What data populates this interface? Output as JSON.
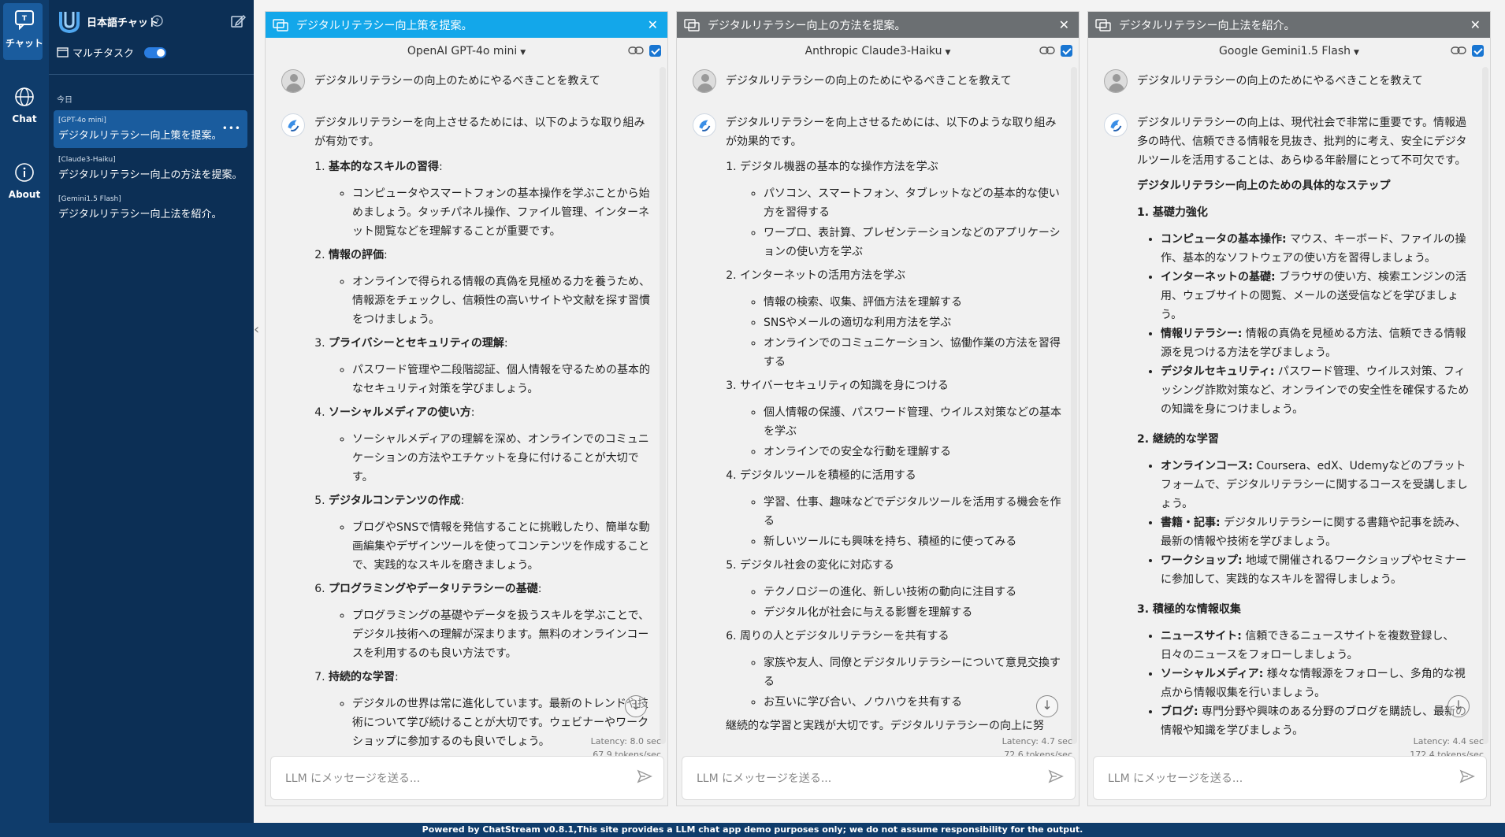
{
  "rail": {
    "chat_label": "チャット",
    "chat2_label": "Chat",
    "about_label": "About"
  },
  "sidebar": {
    "title": "日本語チャット",
    "multitask_label": "マルチタスク",
    "today_label": "今日",
    "history": [
      {
        "tag": "[GPT-4o mini]",
        "title": "デジタルリテラシー向上策を提案。"
      },
      {
        "tag": "[Claude3-Haiku]",
        "title": "デジタルリテラシー向上の方法を提案。"
      },
      {
        "tag": "[Gemini1.5 Flash]",
        "title": "デジタルリテラシー向上法を紹介。"
      }
    ],
    "more_glyph": "•••"
  },
  "panels": [
    {
      "title": "デジタルリテラシー向上策を提案。",
      "model": "OpenAI GPT-4o mini",
      "user_message": "デジタルリテラシーの向上のためにやるべきことを教えて",
      "intro": "デジタルリテラシーを向上させるためには、以下のような取り組みが有効です。",
      "items": [
        {
          "heading": "基本的なスキルの習得",
          "bullets": [
            "コンピュータやスマートフォンの基本操作を学ぶことから始めましょう。タッチパネル操作、ファイル管理、インターネット閲覧などを理解することが重要です。"
          ]
        },
        {
          "heading": "情報の評価",
          "bullets": [
            "オンラインで得られる情報の真偽を見極める力を養うため、情報源をチェックし、信頼性の高いサイトや文献を探す習慣をつけましょう。"
          ]
        },
        {
          "heading": "プライバシーとセキュリティの理解",
          "bullets": [
            "パスワード管理や二段階認証、個人情報を守るための基本的なセキュリティ対策を学びましょう。"
          ]
        },
        {
          "heading": "ソーシャルメディアの使い方",
          "bullets": [
            "ソーシャルメディアの理解を深め、オンラインでのコミュニケーションの方法やエチケットを身に付けることが大切です。"
          ]
        },
        {
          "heading": "デジタルコンテンツの作成",
          "bullets": [
            "ブログやSNSで情報を発信することに挑戦したり、簡単な動画編集やデザインツールを使ってコンテンツを作成することで、実践的なスキルを磨きましょう。"
          ]
        },
        {
          "heading": "プログラミングやデータリテラシーの基礎",
          "bullets": [
            "プログラミングの基礎やデータを扱うスキルを学ぶことで、デジタル技術への理解が深まります。無料のオンラインコースを利用するのも良い方法です。"
          ]
        },
        {
          "heading": "持続的な学習",
          "bullets": [
            "デジタルの世界は常に進化しています。最新のトレンドや技術について学び続けることが大切です。ウェビナーやワークショップに参加するのも良いでしょう。"
          ]
        }
      ],
      "latency": "Latency: 8.0 sec",
      "tps": "67.9 tokens/sec",
      "placeholder": "LLM にメッセージを送る..."
    },
    {
      "title": "デジタルリテラシー向上の方法を提案。",
      "model": "Anthropic Claude3-Haiku",
      "user_message": "デジタルリテラシーの向上のためにやるべきことを教えて",
      "intro": "デジタルリテラシーを向上させるためには、以下のような取り組みが効果的です。",
      "items": [
        {
          "heading": "デジタル機器の基本的な操作方法を学ぶ",
          "bullets": [
            "パソコン、スマートフォン、タブレットなどの基本的な使い方を習得する",
            "ワープロ、表計算、プレゼンテーションなどのアプリケーションの使い方を学ぶ"
          ]
        },
        {
          "heading": "インターネットの活用方法を学ぶ",
          "bullets": [
            "情報の検索、収集、評価方法を理解する",
            "SNSやメールの適切な利用方法を学ぶ",
            "オンラインでのコミュニケーション、協働作業の方法を習得する"
          ]
        },
        {
          "heading": "サイバーセキュリティの知識を身につける",
          "bullets": [
            "個人情報の保護、パスワード管理、ウイルス対策などの基本を学ぶ",
            "オンラインでの安全な行動を理解する"
          ]
        },
        {
          "heading": "デジタルツールを積極的に活用する",
          "bullets": [
            "学習、仕事、趣味などでデジタルツールを活用する機会を作る",
            "新しいツールにも興味を持ち、積極的に使ってみる"
          ]
        },
        {
          "heading": "デジタル社会の変化に対応する",
          "bullets": [
            "テクノロジーの進化、新しい技術の動向に注目する",
            "デジタル化が社会に与える影響を理解する"
          ]
        },
        {
          "heading": "周りの人とデジタルリテラシーを共有する",
          "bullets": [
            "家族や友人、同僚とデジタルリテラシーについて意見交換する",
            "お互いに学び合い、ノウハウを共有する"
          ]
        }
      ],
      "outro": "継続的な学習と実践が大切です。デジタルリテラシーの向上に努",
      "latency": "Latency: 4.7 sec",
      "tps": "72.6 tokens/sec",
      "placeholder": "LLM にメッセージを送る..."
    },
    {
      "title": "デジタルリテラシー向上法を紹介。",
      "model": "Google Gemini1.5 Flash",
      "user_message": "デジタルリテラシーの向上のためにやるべきことを教えて",
      "intro": "デジタルリテラシーの向上は、現代社会で非常に重要です。情報過多の時代、信頼できる情報を見抜き、批判的に考え、安全にデジタルツールを活用することは、あらゆる年齢層にとって不可欠です。",
      "heading": "デジタルリテラシー向上のための具体的なステップ",
      "sections": [
        {
          "heading": "1. 基礎力強化",
          "bullets": [
            {
              "b": "コンピュータの基本操作:",
              "t": " マウス、キーボード、ファイルの操作、基本的なソフトウェアの使い方を習得しましょう。"
            },
            {
              "b": "インターネットの基礎:",
              "t": " ブラウザの使い方、検索エンジンの活用、ウェブサイトの閲覧、メールの送受信などを学びましょう。"
            },
            {
              "b": "情報リテラシー:",
              "t": " 情報の真偽を見極める方法、信頼できる情報源を見つける方法を学びましょう。"
            },
            {
              "b": "デジタルセキュリティ:",
              "t": " パスワード管理、ウイルス対策、フィッシング詐欺対策など、オンラインでの安全性を確保するための知識を身につけましょう。"
            }
          ]
        },
        {
          "heading": "2. 継続的な学習",
          "bullets": [
            {
              "b": "オンラインコース:",
              "t": " Coursera、edX、Udemyなどのプラットフォームで、デジタルリテラシーに関するコースを受講しましょう。"
            },
            {
              "b": "書籍・記事:",
              "t": " デジタルリテラシーに関する書籍や記事を読み、最新の情報や技術を学びましょう。"
            },
            {
              "b": "ワークショップ:",
              "t": " 地域で開催されるワークショップやセミナーに参加して、実践的なスキルを習得しましょう。"
            }
          ]
        },
        {
          "heading": "3. 積極的な情報収集",
          "bullets": [
            {
              "b": "ニュースサイト:",
              "t": " 信頼できるニュースサイトを複数登録し、日々のニュースをフォローしましょう。"
            },
            {
              "b": "ソーシャルメディア:",
              "t": " 様々な情報源をフォローし、多角的な視点から情報収集を行いましょう。"
            },
            {
              "b": "ブログ:",
              "t": " 専門分野や興味のある分野のブログを購読し、最新の情報や知識を学びましょう。"
            }
          ]
        }
      ],
      "latency": "Latency: 4.4 sec",
      "tps": "172.4 tokens/sec",
      "placeholder": "LLM にメッセージを送る..."
    }
  ],
  "footer": "Powered by ChatStream v0.8.1,This site provides a LLM chat app demo purposes only; we do not assume responsibility for the output.",
  "colors": {
    "active_title": "#13a7ea",
    "inactive_title": "#6b6f72",
    "sidebar": "#0c2f55",
    "rail": "#0f3c6b"
  }
}
